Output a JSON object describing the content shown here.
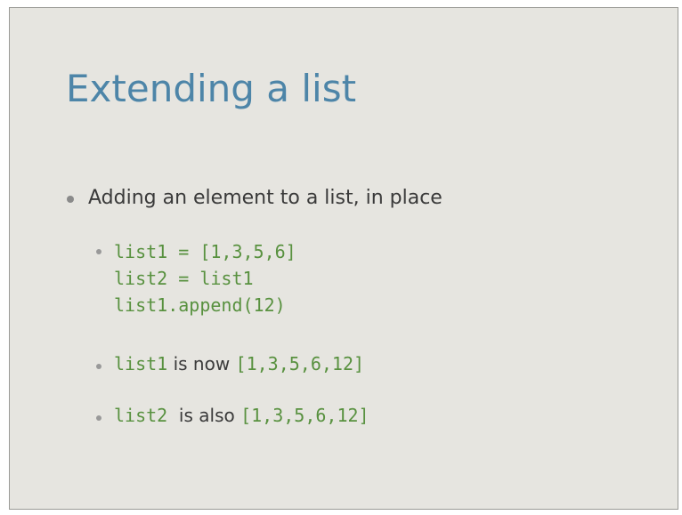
{
  "slide": {
    "title": "Extending a list",
    "bullet_main": "Adding an element to a list, in place",
    "code_lines": [
      "list1 = [1,3,5,6]",
      "list2 = list1",
      "list1.append(12)"
    ],
    "bullet2": {
      "code_a": "list1",
      "text": " is now ",
      "code_b": "[1,3,5,6,12]"
    },
    "bullet3": {
      "code_a": "list2",
      "text": "  is also ",
      "code_b": "[1,3,5,6,12]"
    }
  },
  "colors": {
    "background": "#e6e5e0",
    "title": "#4d85a8",
    "code": "#58913f",
    "text": "#3a3a3a"
  },
  "icons": {
    "bullet": "bullet-dot-icon"
  }
}
